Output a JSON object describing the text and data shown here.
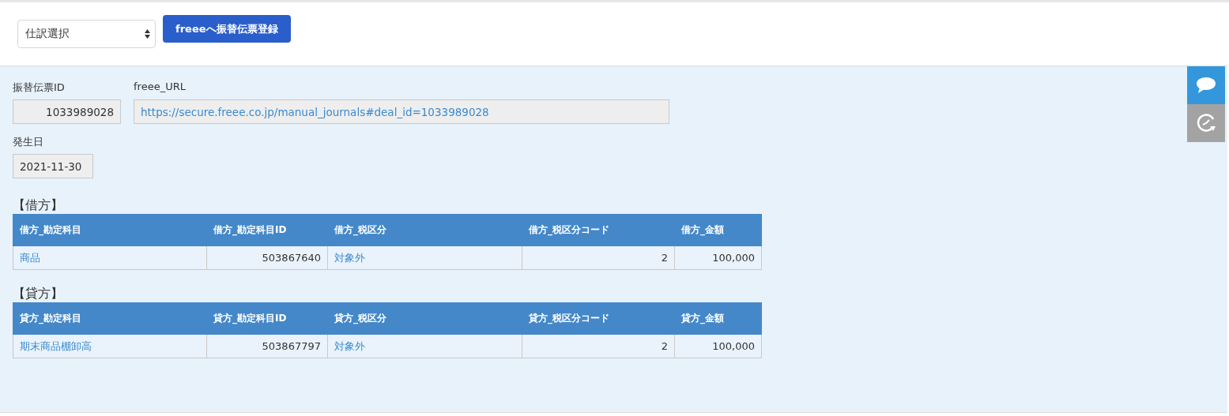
{
  "toolbar": {
    "select": {
      "value": "仕訳選択"
    },
    "register_button": "freeeへ振替伝票登録"
  },
  "fields": [
    {
      "label": "振替伝票ID",
      "value": "1033989028",
      "kind": "number"
    },
    {
      "label": "freee_URL",
      "value": "https://secure.freee.co.jp/manual_journals#deal_id=1033989028",
      "kind": "link"
    }
  ],
  "date_field": {
    "label": "発生日",
    "value": "2021-11-30"
  },
  "sections": [
    {
      "title": "【借方】",
      "columns": [
        {
          "label": "借方_勘定科目",
          "kind": "link"
        },
        {
          "label": "借方_勘定科目ID",
          "kind": "number"
        },
        {
          "label": "借方_税区分",
          "kind": "link"
        },
        {
          "label": "借方_税区分コード",
          "kind": "number"
        },
        {
          "label": "借方_金額",
          "kind": "number"
        }
      ],
      "rows": [
        [
          "商品",
          "503867640",
          "対象外",
          "2",
          "100,000"
        ]
      ]
    },
    {
      "title": "【貸方】",
      "columns": [
        {
          "label": "貸方_勘定科目",
          "kind": "link"
        },
        {
          "label": "貸方_勘定科目ID",
          "kind": "number"
        },
        {
          "label": "貸方_税区分",
          "kind": "link"
        },
        {
          "label": "貸方_税区分コード",
          "kind": "number"
        },
        {
          "label": "貸方_金額",
          "kind": "number"
        }
      ],
      "rows": [
        [
          "期末商品棚卸高",
          "503867797",
          "対象外",
          "2",
          "100,000"
        ]
      ]
    }
  ]
}
